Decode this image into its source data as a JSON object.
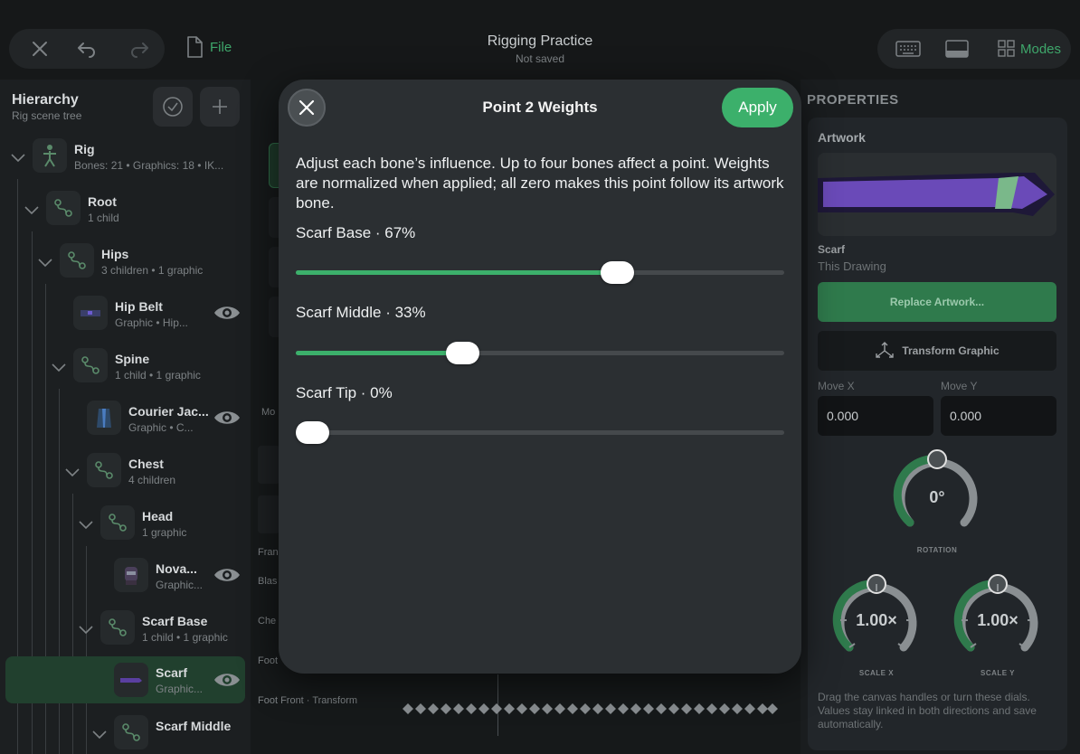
{
  "topbar": {
    "file_label": "File",
    "title": "Rigging Practice",
    "subtitle": "Not saved",
    "modes_label": "Modes"
  },
  "hierarchy": {
    "title": "Hierarchy",
    "subtitle": "Rig scene tree",
    "nodes": [
      {
        "name": "Rig",
        "sub": "Bones: 21  •  Graphics: 18  •  IK..."
      },
      {
        "name": "Root",
        "sub": "1 child"
      },
      {
        "name": "Hips",
        "sub": "3 children  •  1 graphic"
      },
      {
        "name": "Hip Belt",
        "sub": "Graphic  •  Hip..."
      },
      {
        "name": "Spine",
        "sub": "1 child  •  1 graphic"
      },
      {
        "name": "Courier Jac...",
        "sub": "Graphic  •  C..."
      },
      {
        "name": "Chest",
        "sub": "4 children"
      },
      {
        "name": "Head",
        "sub": "1 graphic"
      },
      {
        "name": "Nova...",
        "sub": "Graphic..."
      },
      {
        "name": "Scarf Base",
        "sub": "1 child  •  1 graphic"
      },
      {
        "name": "Scarf",
        "sub": "Graphic..."
      },
      {
        "name": "Scarf Middle",
        "sub": ""
      }
    ]
  },
  "middle": {
    "labels": [
      "Mo",
      "Fran",
      "Blas",
      "Che",
      "Foot",
      "Foot Front · Transform"
    ]
  },
  "modal": {
    "title": "Point 2 Weights",
    "apply_label": "Apply",
    "description": "Adjust each bone’s influence. Up to four bones affect a point. Weights are normalized when applied; all zero makes this point follow its artwork bone.",
    "weights": [
      {
        "label": "Scarf Base · 67%",
        "value": 0.67
      },
      {
        "label": "Scarf Middle · 33%",
        "value": 0.33
      },
      {
        "label": "Scarf Tip · 0%",
        "value": 0.0
      }
    ]
  },
  "properties": {
    "title": "PROPERTIES",
    "artwork_label": "Artwork",
    "artwork_name": "Scarf",
    "artwork_source": "This Drawing",
    "replace_label": "Replace Artwork...",
    "transform_label": "Transform Graphic",
    "move_x_label": "Move X",
    "move_y_label": "Move Y",
    "move_x_value": "0.000",
    "move_y_value": "0.000",
    "rotation_value": "0°",
    "rotation_label": "ROTATION",
    "scale_x_value": "1.00×",
    "scale_x_label": "SCALE X",
    "scale_y_value": "1.00×",
    "scale_y_label": "SCALE Y",
    "help_text": "Drag the canvas handles or turn these dials. Values stay linked in both directions and save automatically."
  },
  "colors": {
    "accent": "#3cb06b",
    "modal_bg": "#2b2f32",
    "panel_bg": "#1c1f21"
  }
}
